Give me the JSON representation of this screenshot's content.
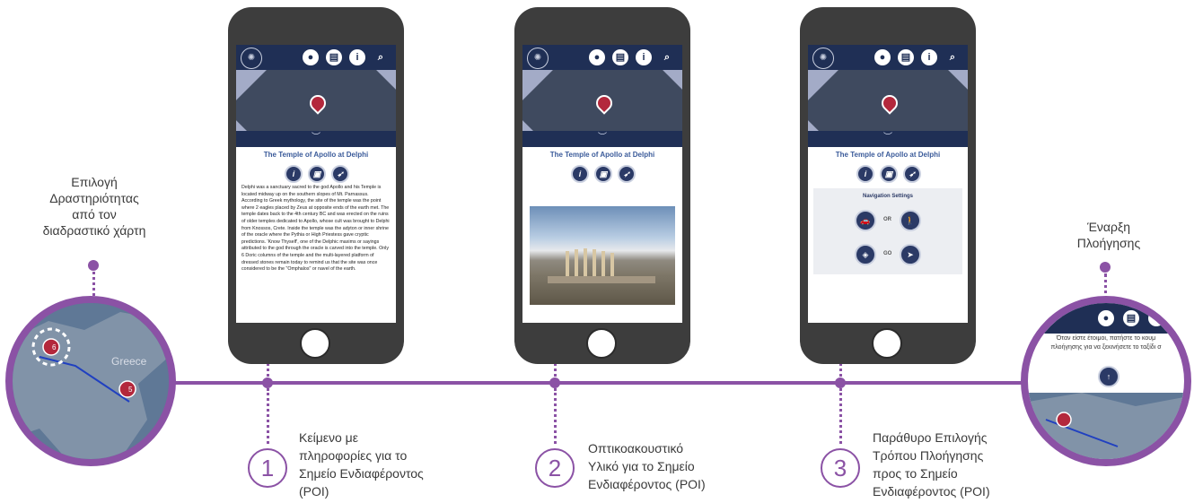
{
  "left_label": "Επιλογή\nΔραστηριότητας\nαπό τον\nδιαδραστικό χάρτη",
  "right_label": "Έναρξη\nΠλοήγησης",
  "steps": [
    {
      "num": "1",
      "text": "Κείμενο με\nπληροφορίες για το\nΣημείο Ενδιαφέροντος\n(POI)"
    },
    {
      "num": "2",
      "text": "Οπτικοακουστικό\nΥλικό για το Σημείο\nΕνδιαφέροντος (POI)"
    },
    {
      "num": "3",
      "text": "Παράθυρο Επιλογής\nΤρόπου Πλοήγησης\nπρος το Σημείο\nΕνδιαφέροντος (POI)"
    }
  ],
  "phone": {
    "poi_title": "The Temple of Apollo at Delphi",
    "info_text": "Delphi was a sanctuary sacred to the god Apollo and his Temple is located midway up on the southern slopes of Mt. Parnassus. According to Greek mythology, the site of the temple was the point where 2 eagles placed by Zeus at opposite ends of the earth met. The temple dates back to the 4th century BC and was erected on the ruins of older temples dedicated to Apollo, whose cult was brought to Delphi from Knossos, Crete. Inside the temple was the adyton or inner shrine of the oracle where the Pythia or High Priestess gave cryptic predictions. 'Know Thyself', one of the Delphic maxims or sayings attributed to the god through the oracle is carved into the temple. Only 6 Doric columns of the temple and the multi-layered platform of dressed stones remain today to remind us that the site was once considered to be the \"Omphalos\" or navel of the earth.",
    "nav_settings": "Navigation Settings",
    "or_label": "OR",
    "go_label": "GO"
  },
  "right_circle": {
    "message_line1": "Όταν είστε έτοιμοι, πατήστε το κουμ",
    "message_line2": "πλοήγησης για να ξεκινήσετε το ταξίδι σ"
  },
  "left_circle": {
    "country_label": "Greece",
    "pin1": "6",
    "pin2": "5"
  },
  "colors": {
    "accent": "#8b52a5",
    "navy": "#1f2f55",
    "phone": "#3d3d3d"
  }
}
